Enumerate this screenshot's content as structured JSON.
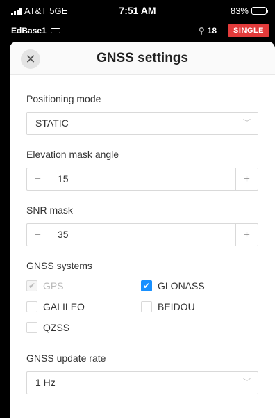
{
  "status_bar": {
    "carrier": "AT&T",
    "network": "5GE",
    "time": "7:51 AM",
    "battery": "83%",
    "battery_level": 0.83
  },
  "device_bar": {
    "device_name": "EdBase1",
    "satellite_count": "18",
    "mode_badge": "SINGLE",
    "badge_color": "#e23b3b"
  },
  "sheet": {
    "title": "GNSS settings",
    "close_icon": "close-icon",
    "positioning_mode": {
      "label": "Positioning mode",
      "value": "STATIC"
    },
    "elevation_mask": {
      "label": "Elevation mask angle",
      "minus": "−",
      "value": "15",
      "plus": "+"
    },
    "snr_mask": {
      "label": "SNR mask",
      "minus": "−",
      "value": "35",
      "plus": "+"
    },
    "gnss_systems": {
      "label": "GNSS systems",
      "items": [
        {
          "name": "GPS",
          "checked": true,
          "disabled": true
        },
        {
          "name": "GLONASS",
          "checked": true,
          "disabled": false
        },
        {
          "name": "GALILEO",
          "checked": false,
          "disabled": false
        },
        {
          "name": "BEIDOU",
          "checked": false,
          "disabled": false
        },
        {
          "name": "QZSS",
          "checked": false,
          "disabled": false
        }
      ]
    },
    "update_rate": {
      "label": "GNSS update rate",
      "value": "1 Hz"
    }
  },
  "colors": {
    "accent": "#1890ff"
  }
}
